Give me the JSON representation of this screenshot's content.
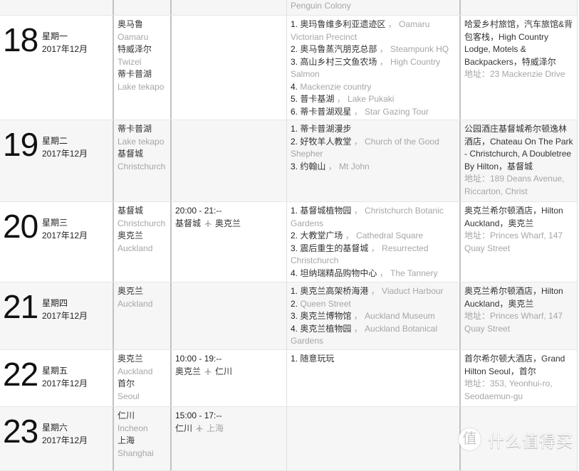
{
  "labels": {
    "attraction_separator": " ， "
  },
  "carryover_row": {
    "attractions_tail": "Penguin Colony"
  },
  "days": [
    {
      "day": "18",
      "weekday": "星期一",
      "year_month": "2017年12月",
      "cities": [
        {
          "zh": "奥马鲁",
          "en": "Oamaru"
        },
        {
          "zh": "特威泽尔",
          "en": "Twizel"
        },
        {
          "zh": "蒂卡普湖",
          "en": "Lake tekapo"
        }
      ],
      "transport": null,
      "attractions": [
        {
          "num": "1.",
          "zh": "奥玛鲁维多利亚遗迹区",
          "en": "Oamaru Victorian Precinct"
        },
        {
          "num": "2.",
          "zh": "奥马鲁蒸汽朋克总部",
          "en": "Steampunk HQ"
        },
        {
          "num": "3.",
          "zh": "高山乡村三文鱼农场",
          "en": "High Country Salmon"
        },
        {
          "num": "4.",
          "zh": "",
          "en": "Mackenzie country"
        },
        {
          "num": "5.",
          "zh": "普卡基湖",
          "en": "Lake Pukaki"
        },
        {
          "num": "6.",
          "zh": "蒂卡普湖观星",
          "en": "Star Gazing Tour"
        }
      ],
      "hotel": {
        "name": "哈爱乡村旅馆，汽车旅馆&背包客栈，High Country Lodge, Motels & Backpackers，特威泽尔",
        "address": "地址：23 Mackenzie Drive"
      }
    },
    {
      "day": "19",
      "weekday": "星期二",
      "year_month": "2017年12月",
      "cities": [
        {
          "zh": "蒂卡普湖",
          "en": "Lake tekapo"
        },
        {
          "zh": "基督城",
          "en": "Christchurch"
        }
      ],
      "transport": null,
      "attractions": [
        {
          "num": "1.",
          "zh": "蒂卡普湖漫步",
          "en": ""
        },
        {
          "num": "2.",
          "zh": "好牧羊人教堂",
          "en": "Church of the Good Shepher"
        },
        {
          "num": "3.",
          "zh": "约翰山",
          "en": "Mt John"
        }
      ],
      "hotel": {
        "name": "公园酒庄基督城希尔顿逸林酒店，Chateau On The Park - Christchurch, A Doubletree By Hilton，基督城",
        "address": "地址：189 Deans Avenue, Riccarton, Christ"
      }
    },
    {
      "day": "20",
      "weekday": "星期三",
      "year_month": "2017年12月",
      "cities": [
        {
          "zh": "基督城",
          "en": "Christchurch"
        },
        {
          "zh": "奥克兰",
          "en": "Auckland"
        }
      ],
      "transport": {
        "time": "20:00 - 21:--",
        "from": "基督城",
        "to": "奥克兰",
        "to_pending": false
      },
      "attractions": [
        {
          "num": "1.",
          "zh": "基督城植物园",
          "en": "Christchurch Botanic Gardens"
        },
        {
          "num": "2.",
          "zh": "大教堂广场",
          "en": "Cathedral Square"
        },
        {
          "num": "3.",
          "zh": "震后重生的基督城",
          "en": "Resurrected Christchurch"
        },
        {
          "num": "4.",
          "zh": "坦纳瑞精品购物中心",
          "en": "The Tannery"
        }
      ],
      "hotel": {
        "name": "奥克兰希尔顿酒店，Hilton Auckland，奥克兰",
        "address": "地址：Princes Wharf, 147 Quay Street"
      }
    },
    {
      "day": "21",
      "weekday": "星期四",
      "year_month": "2017年12月",
      "cities": [
        {
          "zh": "奥克兰",
          "en": "Auckland"
        }
      ],
      "transport": null,
      "attractions": [
        {
          "num": "1.",
          "zh": "奥克兰高架桥海港",
          "en": "Viaduct Harbour"
        },
        {
          "num": "2.",
          "zh": "",
          "en": "Queen Street"
        },
        {
          "num": "3.",
          "zh": "奥克兰博物馆",
          "en": "Auckland Museum"
        },
        {
          "num": "4.",
          "zh": "奥克兰植物园",
          "en": "Auckland Botanical Gardens"
        }
      ],
      "hotel": {
        "name": "奥克兰希尔顿酒店，Hilton Auckland，奥克兰",
        "address": "地址：Princes Wharf, 147 Quay Street"
      }
    },
    {
      "day": "22",
      "weekday": "星期五",
      "year_month": "2017年12月",
      "cities": [
        {
          "zh": "奥克兰",
          "en": "Auckland"
        },
        {
          "zh": "首尔",
          "en": "Seoul"
        }
      ],
      "transport": {
        "time": "10:00 - 19:--",
        "from": "奥克兰",
        "to": "仁川",
        "to_pending": false
      },
      "attractions": [
        {
          "num": "1.",
          "zh": "随意玩玩",
          "en": ""
        }
      ],
      "hotel": {
        "name": "首尔希尔顿大酒店，Grand Hilton Seoul，首尔",
        "address": "地址：353, Yeonhui-ro, Seodaemun-gu"
      }
    },
    {
      "day": "23",
      "weekday": "星期六",
      "year_month": "2017年12月",
      "cities": [
        {
          "zh": "仁川",
          "en": "Incheon"
        },
        {
          "zh": "上海",
          "en": "Shanghai"
        }
      ],
      "transport": {
        "time": "15:00 - 17:--",
        "from": "仁川",
        "to": "上海",
        "to_pending": true
      },
      "attractions": [],
      "hotel": null
    }
  ],
  "watermark": {
    "badge": "值",
    "text": "什么值得买"
  },
  "icons": {
    "transport_arrow": "airplane-icon"
  }
}
